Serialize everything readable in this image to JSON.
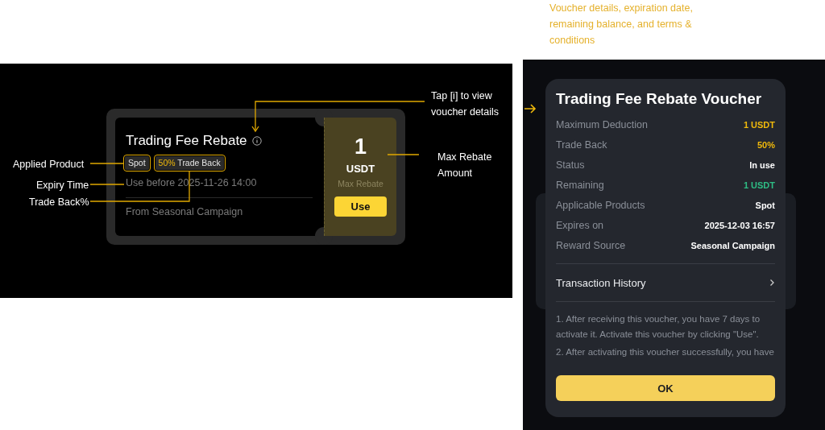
{
  "caption": "Voucher details, expiration date, remaining balance, and terms & conditions",
  "annotations": [
    {
      "kind": "product",
      "lines": [
        "Applied Product"
      ]
    },
    {
      "kind": "expiry",
      "lines": [
        "Expiry Time"
      ]
    },
    {
      "kind": "tradeback",
      "lines": [
        "Trade Back%"
      ]
    },
    {
      "kind": "info",
      "lines": [
        "Tap [i] to view",
        "voucher details"
      ]
    },
    {
      "kind": "amount",
      "lines": [
        "Max Rebate",
        "Amount"
      ]
    }
  ],
  "voucher": {
    "title": "Trading Fee Rebate",
    "tags": [
      {
        "label": "Spot"
      },
      {
        "accent": "50%",
        "label": "Trade Back"
      }
    ],
    "expiry": "Use before 2025-11-26 14:00",
    "source": "From Seasonal Campaign",
    "amount": "1",
    "unit": "USDT",
    "amount_label": "Max Rebate",
    "button": "Use"
  },
  "modal": {
    "title": "Trading Fee Rebate Voucher",
    "rows": [
      {
        "label": "Maximum Deduction",
        "value": "1 USDT",
        "color": "#f0b90b"
      },
      {
        "label": "Trade Back",
        "value": "50%",
        "color": "#f0b90b"
      },
      {
        "label": "Status",
        "value": "In use",
        "color": "#ffffff"
      },
      {
        "label": "Remaining",
        "value": "1 USDT",
        "color": "#2ebd85"
      },
      {
        "label": "Applicable Products",
        "value": "Spot",
        "color": "#ffffff"
      },
      {
        "label": "Expires on",
        "value": "2025-12-03 16:57",
        "color": "#ffffff"
      },
      {
        "label": "Reward Source",
        "value": "Seasonal Campaign",
        "color": "#ffffff"
      }
    ],
    "link": "Transaction History",
    "terms": [
      "1. After receiving this voucher, you have 7 days to activate it. Activate this voucher by clicking \"Use\".",
      "2. After activating this voucher successfully, you have"
    ],
    "button": "OK"
  }
}
